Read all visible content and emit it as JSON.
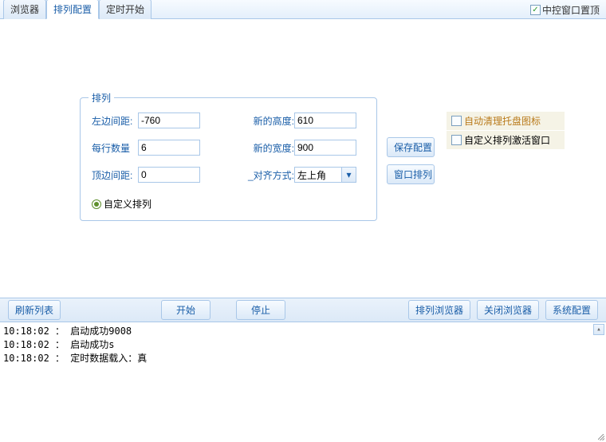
{
  "top_checkbox": {
    "label": "中控窗口置顶",
    "checked": true
  },
  "tabs": [
    {
      "label": "浏览器",
      "active": false
    },
    {
      "label": "排列配置",
      "active": true
    },
    {
      "label": "定时开始",
      "active": false
    }
  ],
  "group": {
    "title": "排列",
    "left_margin_label": "左边间距:",
    "left_margin_value": "-760",
    "per_row_label": "每行数量",
    "per_row_value": "6",
    "top_margin_label": "顶边间距:",
    "top_margin_value": "0",
    "new_height_label": "新的高度:",
    "new_height_value": "610",
    "new_width_label": "新的宽度:",
    "new_width_value": "900",
    "align_label": "_对齐方式:",
    "align_value": "左上角",
    "radio_custom_label": "自定义排列"
  },
  "side_buttons": {
    "save_config": "保存配置",
    "arrange_window": "窗口排列"
  },
  "options": {
    "auto_clear_tray": {
      "label": "自动清理托盘图标",
      "checked": false
    },
    "custom_activate": {
      "label": "自定义排列激活窗口",
      "checked": false
    }
  },
  "toolbar": {
    "refresh_list": "刷新列表",
    "start": "开始",
    "stop": "停止",
    "arrange_browser": "排列浏览器",
    "close_browser": "关闭浏览器",
    "system_config": "系统配置"
  },
  "log": {
    "lines": [
      "10:18:02 ： 启动成功9008",
      "10:18:02 ： 启动成功s",
      "10:18:02 ： 定时数据载入：真"
    ]
  }
}
